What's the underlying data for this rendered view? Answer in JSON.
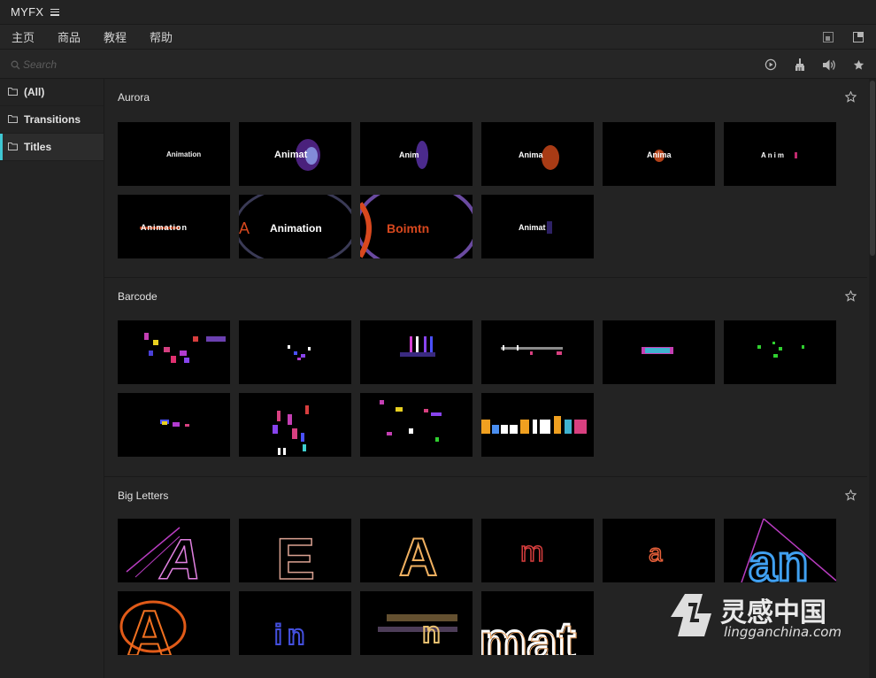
{
  "app": {
    "title": "MYFX"
  },
  "menu": {
    "items": [
      "主页",
      "商品",
      "教程",
      "帮助"
    ]
  },
  "search": {
    "placeholder": "Search",
    "value": ""
  },
  "sidebar": {
    "items": [
      {
        "label": "(All)",
        "active": false
      },
      {
        "label": "Transitions",
        "active": false
      },
      {
        "label": "Titles",
        "active": true
      }
    ]
  },
  "sections": [
    {
      "name": "Aurora",
      "items": [
        {
          "word": "Animation"
        },
        {
          "word": "Animat"
        },
        {
          "word": "Anim"
        },
        {
          "word": "Anima"
        },
        {
          "word": "Anima"
        },
        {
          "word": "Anim"
        },
        {
          "word": "Animation"
        },
        {
          "word": "Animation"
        },
        {
          "word": "Boimtn"
        },
        {
          "word": "Animat"
        }
      ]
    },
    {
      "name": "Barcode",
      "items": [
        {},
        {},
        {},
        {},
        {},
        {},
        {},
        {},
        {},
        {}
      ]
    },
    {
      "name": "Big Letters",
      "items": [
        {
          "word": "A"
        },
        {
          "word": "E"
        },
        {
          "word": "A"
        },
        {
          "word": "m"
        },
        {
          "word": "a"
        },
        {
          "word": "an"
        },
        {
          "word": "A"
        },
        {
          "word": "in"
        },
        {
          "word": "n"
        },
        {
          "word": "mat"
        }
      ]
    }
  ],
  "watermark": {
    "text": "灵感中国",
    "url": "lingganchina.com"
  },
  "colors": {
    "accent": "#3fc7d3",
    "background": "#232323",
    "thumb_bg": "#000000"
  },
  "icons": {
    "menu": "hamburger-icon",
    "window_restore": "window-restore-icon",
    "window_maximize": "window-maximize-icon",
    "search": "search-icon",
    "play": "play-icon",
    "brush": "brush-icon",
    "volume": "volume-icon",
    "favorite": "star-icon",
    "folder": "folder-icon"
  }
}
